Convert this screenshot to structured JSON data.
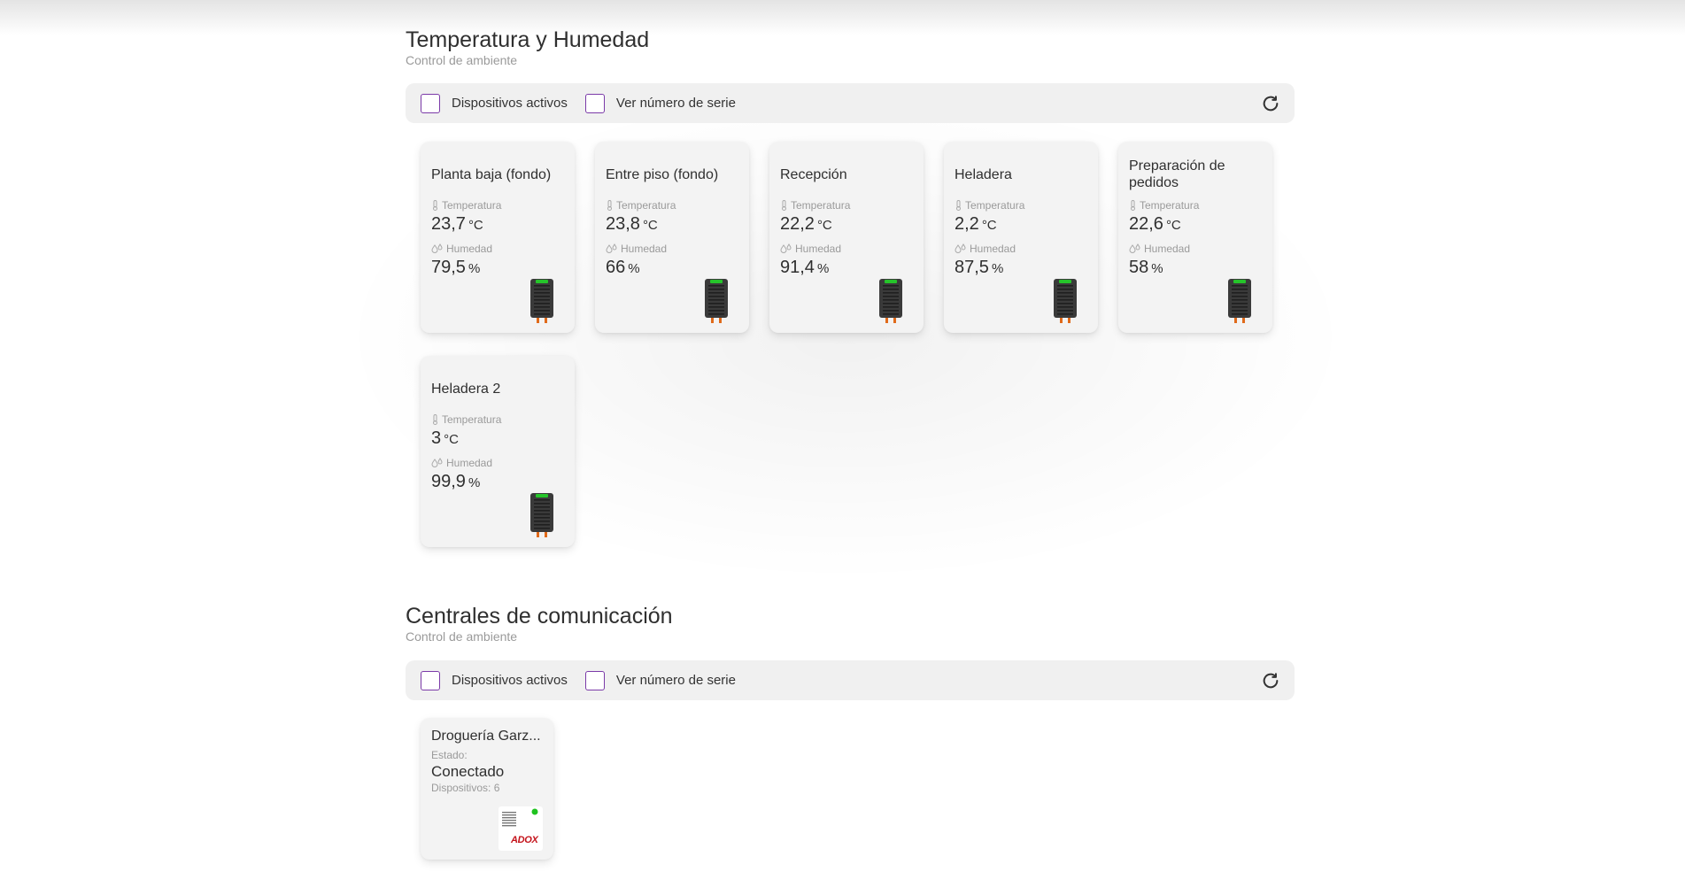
{
  "sections": [
    {
      "title": "Temperatura y Humedad",
      "subtitle": "Control de ambiente",
      "toolbar": {
        "active_devices_label": "Dispositivos activos",
        "serial_number_label": "Ver número de serie"
      },
      "cards": [
        {
          "name": "Planta baja (fondo)",
          "temperature_label": "Temperatura",
          "temperature": "23,7",
          "temperature_unit": "°C",
          "humidity_label": "Humedad",
          "humidity": "79,5",
          "humidity_unit": "%"
        },
        {
          "name": "Entre piso (fondo)",
          "temperature_label": "Temperatura",
          "temperature": "23,8",
          "temperature_unit": "°C",
          "humidity_label": "Humedad",
          "humidity": "66",
          "humidity_unit": "%"
        },
        {
          "name": "Recepción",
          "temperature_label": "Temperatura",
          "temperature": "22,2",
          "temperature_unit": "°C",
          "humidity_label": "Humedad",
          "humidity": "91,4",
          "humidity_unit": "%"
        },
        {
          "name": "Heladera",
          "temperature_label": "Temperatura",
          "temperature": "2,2",
          "temperature_unit": "°C",
          "humidity_label": "Humedad",
          "humidity": "87,5",
          "humidity_unit": "%"
        },
        {
          "name": "Preparación de pedidos",
          "temperature_label": "Temperatura",
          "temperature": "22,6",
          "temperature_unit": "°C",
          "humidity_label": "Humedad",
          "humidity": "58",
          "humidity_unit": "%"
        },
        {
          "name": "Heladera 2",
          "temperature_label": "Temperatura",
          "temperature": "3",
          "temperature_unit": "°C",
          "humidity_label": "Humedad",
          "humidity": "99,9",
          "humidity_unit": "%"
        }
      ]
    },
    {
      "title": "Centrales de comunicación",
      "subtitle": "Control de ambiente",
      "toolbar": {
        "active_devices_label": "Dispositivos activos",
        "serial_number_label": "Ver número de serie"
      },
      "hubs": [
        {
          "name": "Droguería Garz...",
          "state_label": "Estado:",
          "state": "Conectado",
          "devices": "Dispositivos: 6",
          "brand": "ADOX"
        }
      ]
    }
  ],
  "colors": {
    "checkbox_border": "#7b3aa8",
    "status_led": "#1fc21f",
    "brand": "#c4121a"
  },
  "icons": [
    "thermometer-icon",
    "humidity-icon",
    "refresh-icon",
    "sensor-device-icon",
    "hub-device-icon"
  ]
}
